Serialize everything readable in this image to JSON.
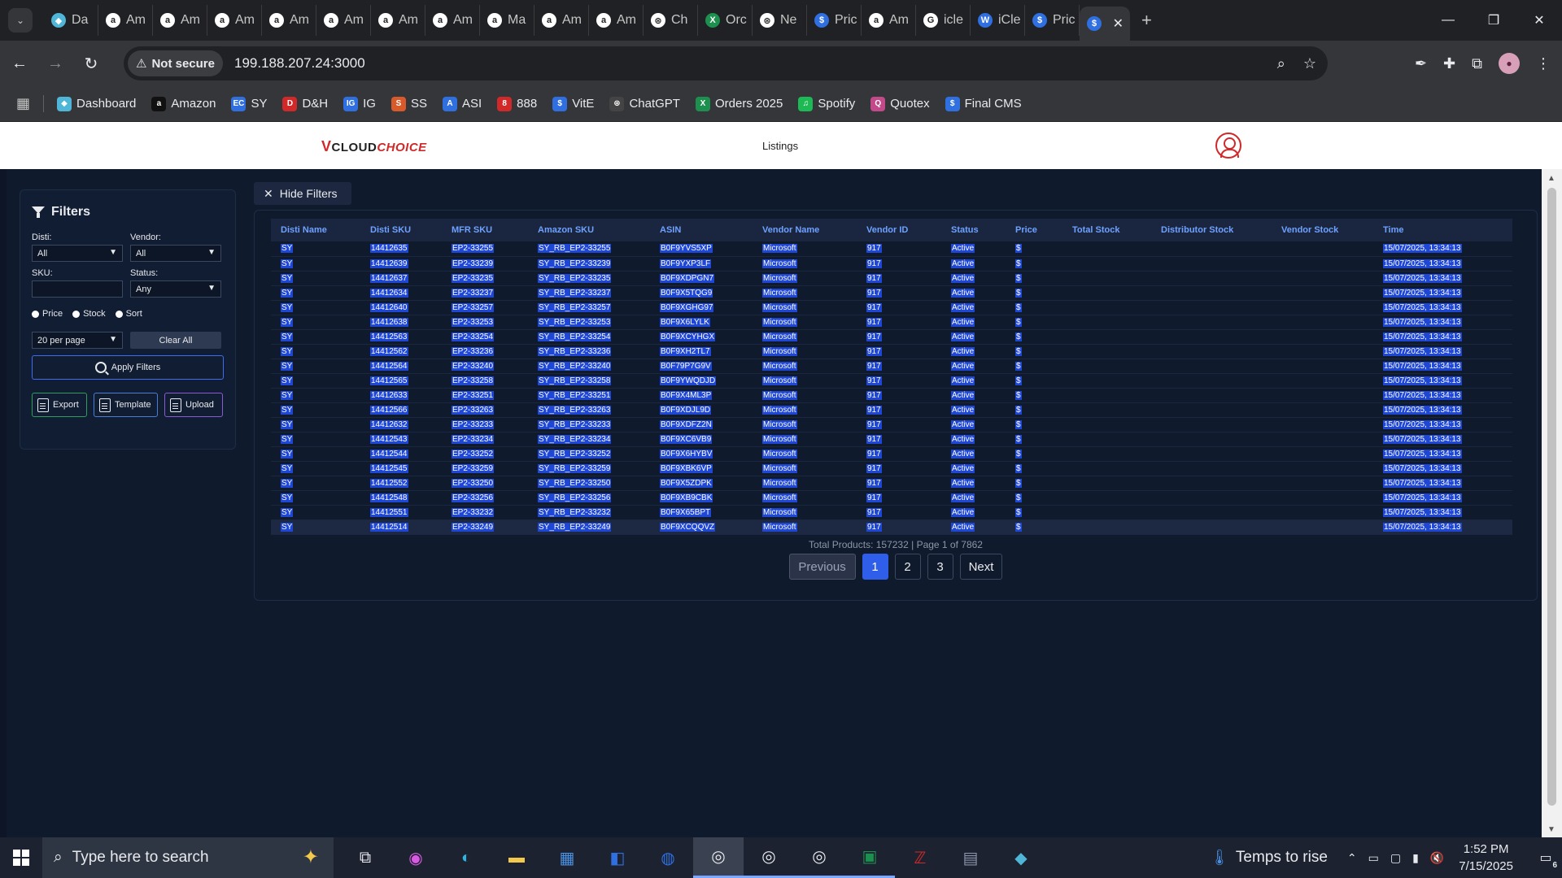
{
  "browser": {
    "tabs": [
      {
        "label": "Da",
        "icon": "diamond-icon",
        "color": "#4fb6d8"
      },
      {
        "label": "Am",
        "icon": "amazon-icon",
        "color": "#ffffff"
      },
      {
        "label": "Am",
        "icon": "amazon-icon",
        "color": "#ffffff"
      },
      {
        "label": "Am",
        "icon": "amazon-icon",
        "color": "#ffffff"
      },
      {
        "label": "Am",
        "icon": "amazon-icon",
        "color": "#ffffff"
      },
      {
        "label": "Am",
        "icon": "amazon-icon",
        "color": "#ffffff"
      },
      {
        "label": "Am",
        "icon": "amazon-icon",
        "color": "#ffffff"
      },
      {
        "label": "Am",
        "icon": "amazon-icon",
        "color": "#ffffff"
      },
      {
        "label": "Ma",
        "icon": "amazon-icon",
        "color": "#ffffff"
      },
      {
        "label": "Am",
        "icon": "amazon-icon",
        "color": "#ffffff"
      },
      {
        "label": "Am",
        "icon": "amazon-icon",
        "color": "#ffffff"
      },
      {
        "label": "Ch",
        "icon": "chatgpt-icon",
        "color": "#ffffff"
      },
      {
        "label": "Orc",
        "icon": "excel-icon",
        "color": "#1d8f4e"
      },
      {
        "label": "Ne",
        "icon": "chatgpt-icon",
        "color": "#ffffff"
      },
      {
        "label": "Pric",
        "icon": "dollar-icon",
        "color": "#2f6fe0"
      },
      {
        "label": "Am",
        "icon": "amazon-icon",
        "color": "#ffffff"
      },
      {
        "label": "icle",
        "icon": "google-icon",
        "color": "#ffffff"
      },
      {
        "label": "iCle",
        "icon": "wordpress-icon",
        "color": "#2f6fe0"
      },
      {
        "label": "Pric",
        "icon": "dollar-icon",
        "color": "#2f6fe0"
      }
    ],
    "active_tab": {
      "icon": "dollar-icon",
      "color": "#2f6fe0",
      "close": "✕"
    },
    "new_tab": "+",
    "security_label": "Not secure",
    "url": "199.188.207.24:3000",
    "bookmarks": [
      {
        "label": "Dashboard",
        "icon": "diamond-icon",
        "color": "#4fb6d8"
      },
      {
        "label": "Amazon",
        "icon": "amazon-icon",
        "color": "#111111"
      },
      {
        "label": "SY",
        "icon": "ec-icon",
        "color": "#2f6fe0"
      },
      {
        "label": "D&H",
        "icon": "dh-icon",
        "color": "#d12929"
      },
      {
        "label": "IG",
        "icon": "ig-icon",
        "color": "#2f6fe0"
      },
      {
        "label": "SS",
        "icon": "ss-icon",
        "color": "#d85a2a"
      },
      {
        "label": "ASI",
        "icon": "asi-icon",
        "color": "#2f6fe0"
      },
      {
        "label": "888",
        "icon": "888-icon",
        "color": "#d12929"
      },
      {
        "label": "VitE",
        "icon": "dollar-icon",
        "color": "#2f6fe0"
      },
      {
        "label": "ChatGPT",
        "icon": "chatgpt-icon",
        "color": "#444444"
      },
      {
        "label": "Orders 2025",
        "icon": "excel-icon",
        "color": "#1d8f4e"
      },
      {
        "label": "Spotify",
        "icon": "spotify-icon",
        "color": "#1db954"
      },
      {
        "label": "Quotex",
        "icon": "quotex-icon",
        "color": "#c24a8a"
      },
      {
        "label": "Final CMS",
        "icon": "dollar-icon",
        "color": "#2f6fe0"
      }
    ]
  },
  "app": {
    "logo_v": "V",
    "logo_text": "CLOUD",
    "logo_choice": "CHOICE",
    "nav_listings": "Listings"
  },
  "filters": {
    "title": "Filters",
    "disti_label": "Disti:",
    "disti_value": "All",
    "vendor_label": "Vendor:",
    "vendor_value": "All",
    "sku_label": "SKU:",
    "sku_value": "",
    "status_label": "Status:",
    "status_value": "Any",
    "radio_price": "Price",
    "radio_stock": "Stock",
    "radio_sort": "Sort",
    "per_page": "20 per page",
    "clear_all": "Clear All",
    "apply": "Apply Filters",
    "export": "Export",
    "template": "Template",
    "upload": "Upload"
  },
  "hide_filters": "Hide Filters",
  "table": {
    "columns": [
      "Disti Name",
      "Disti SKU",
      "MFR SKU",
      "Amazon SKU",
      "ASIN",
      "Vendor Name",
      "Vendor ID",
      "Status",
      "Price",
      "Total Stock",
      "Distributor Stock",
      "Vendor Stock",
      "Time"
    ],
    "rows": [
      [
        "SY",
        "14412635",
        "EP2-33255",
        "SY_RB_EP2-33255",
        "B0F9YVS5XP",
        "Microsoft",
        "917",
        "Active",
        "$",
        "",
        "",
        "",
        "15/07/2025, 13:34:13"
      ],
      [
        "SY",
        "14412639",
        "EP2-33239",
        "SY_RB_EP2-33239",
        "B0F9YXP3LF",
        "Microsoft",
        "917",
        "Active",
        "$",
        "",
        "",
        "",
        "15/07/2025, 13:34:13"
      ],
      [
        "SY",
        "14412637",
        "EP2-33235",
        "SY_RB_EP2-33235",
        "B0F9XDPGN7",
        "Microsoft",
        "917",
        "Active",
        "$",
        "",
        "",
        "",
        "15/07/2025, 13:34:13"
      ],
      [
        "SY",
        "14412634",
        "EP2-33237",
        "SY_RB_EP2-33237",
        "B0F9X5TQG9",
        "Microsoft",
        "917",
        "Active",
        "$",
        "",
        "",
        "",
        "15/07/2025, 13:34:13"
      ],
      [
        "SY",
        "14412640",
        "EP2-33257",
        "SY_RB_EP2-33257",
        "B0F9XGHG97",
        "Microsoft",
        "917",
        "Active",
        "$",
        "",
        "",
        "",
        "15/07/2025, 13:34:13"
      ],
      [
        "SY",
        "14412638",
        "EP2-33253",
        "SY_RB_EP2-33253",
        "B0F9X6LYLK",
        "Microsoft",
        "917",
        "Active",
        "$",
        "",
        "",
        "",
        "15/07/2025, 13:34:13"
      ],
      [
        "SY",
        "14412563",
        "EP2-33254",
        "SY_RB_EP2-33254",
        "B0F9XCYHGX",
        "Microsoft",
        "917",
        "Active",
        "$",
        "",
        "",
        "",
        "15/07/2025, 13:34:13"
      ],
      [
        "SY",
        "14412562",
        "EP2-33236",
        "SY_RB_EP2-33236",
        "B0F9XH2TL7",
        "Microsoft",
        "917",
        "Active",
        "$",
        "",
        "",
        "",
        "15/07/2025, 13:34:13"
      ],
      [
        "SY",
        "14412564",
        "EP2-33240",
        "SY_RB_EP2-33240",
        "B0F79P7G9V",
        "Microsoft",
        "917",
        "Active",
        "$",
        "",
        "",
        "",
        "15/07/2025, 13:34:13"
      ],
      [
        "SY",
        "14412565",
        "EP2-33258",
        "SY_RB_EP2-33258",
        "B0F9YWQDJD",
        "Microsoft",
        "917",
        "Active",
        "$",
        "",
        "",
        "",
        "15/07/2025, 13:34:13"
      ],
      [
        "SY",
        "14412633",
        "EP2-33251",
        "SY_RB_EP2-33251",
        "B0F9X4ML3P",
        "Microsoft",
        "917",
        "Active",
        "$",
        "",
        "",
        "",
        "15/07/2025, 13:34:13"
      ],
      [
        "SY",
        "14412566",
        "EP2-33263",
        "SY_RB_EP2-33263",
        "B0F9XDJL9D",
        "Microsoft",
        "917",
        "Active",
        "$",
        "",
        "",
        "",
        "15/07/2025, 13:34:13"
      ],
      [
        "SY",
        "14412632",
        "EP2-33233",
        "SY_RB_EP2-33233",
        "B0F9XDFZ2N",
        "Microsoft",
        "917",
        "Active",
        "$",
        "",
        "",
        "",
        "15/07/2025, 13:34:13"
      ],
      [
        "SY",
        "14412543",
        "EP2-33234",
        "SY_RB_EP2-33234",
        "B0F9XC6VB9",
        "Microsoft",
        "917",
        "Active",
        "$",
        "",
        "",
        "",
        "15/07/2025, 13:34:13"
      ],
      [
        "SY",
        "14412544",
        "EP2-33252",
        "SY_RB_EP2-33252",
        "B0F9X6HYBV",
        "Microsoft",
        "917",
        "Active",
        "$",
        "",
        "",
        "",
        "15/07/2025, 13:34:13"
      ],
      [
        "SY",
        "14412545",
        "EP2-33259",
        "SY_RB_EP2-33259",
        "B0F9XBK6VP",
        "Microsoft",
        "917",
        "Active",
        "$",
        "",
        "",
        "",
        "15/07/2025, 13:34:13"
      ],
      [
        "SY",
        "14412552",
        "EP2-33250",
        "SY_RB_EP2-33250",
        "B0F9X5ZDPK",
        "Microsoft",
        "917",
        "Active",
        "$",
        "",
        "",
        "",
        "15/07/2025, 13:34:13"
      ],
      [
        "SY",
        "14412548",
        "EP2-33256",
        "SY_RB_EP2-33256",
        "B0F9XB9CBK",
        "Microsoft",
        "917",
        "Active",
        "$",
        "",
        "",
        "",
        "15/07/2025, 13:34:13"
      ],
      [
        "SY",
        "14412551",
        "EP2-33232",
        "SY_RB_EP2-33232",
        "B0F9X65BPT",
        "Microsoft",
        "917",
        "Active",
        "$",
        "",
        "",
        "",
        "15/07/2025, 13:34:13"
      ],
      [
        "SY",
        "14412514",
        "EP2-33249",
        "SY_RB_EP2-33249",
        "B0F9XCQQVZ",
        "Microsoft",
        "917",
        "Active",
        "$",
        "",
        "",
        "",
        "15/07/2025, 13:34:13"
      ]
    ]
  },
  "pagination": {
    "info": "Total Products: 157232 | Page 1 of 7862",
    "previous": "Previous",
    "pages": [
      "1",
      "2",
      "3"
    ],
    "current": "1",
    "next": "Next"
  },
  "taskbar": {
    "search_placeholder": "Type here to search",
    "weather": "Temps to rise",
    "time": "1:52 PM",
    "date": "7/15/2025",
    "notifications": "6"
  }
}
